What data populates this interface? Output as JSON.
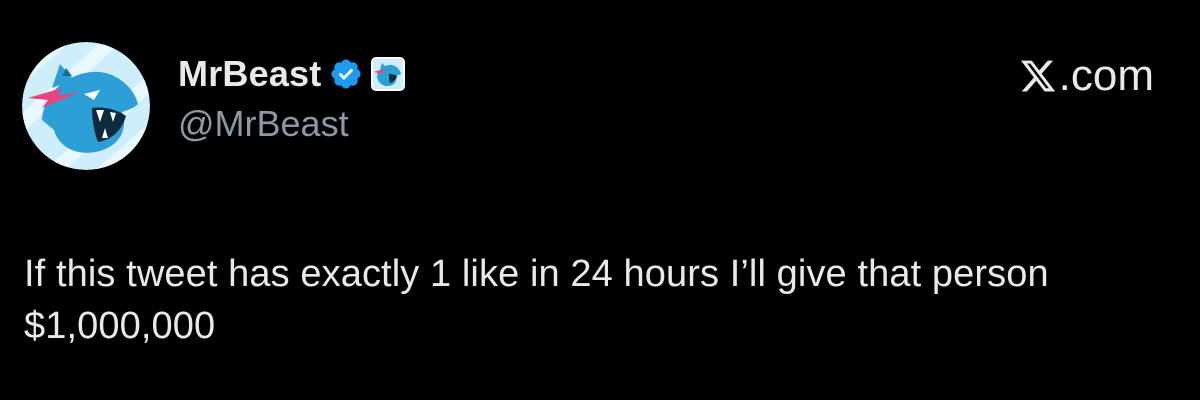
{
  "tweet": {
    "display_name": "MrBeast",
    "handle": "@MrBeast",
    "text": "If this tweet has exactly 1 like in 24 hours I’ll give that person $1,000,000",
    "verified": true,
    "avatar_icon": "mrbeast-panther-logo-icon",
    "affiliate_badge_icon": "mrbeast-affiliate-badge-icon"
  },
  "brand": {
    "icon": "x-logo-icon",
    "label": ".com"
  },
  "colors": {
    "background": "#000000",
    "text_primary": "#e7e9ea",
    "text_secondary": "#8b98a5",
    "verified_blue": "#1d9bf0",
    "avatar_light_blue": "#bfe6f7",
    "logo_pink": "#e8437c"
  }
}
